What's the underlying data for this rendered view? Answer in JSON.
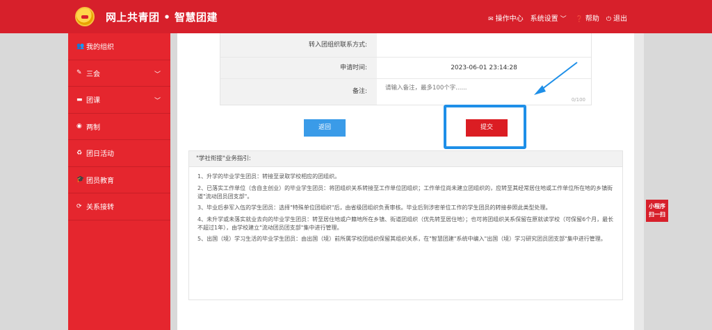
{
  "header": {
    "app_title": "网上共青团 • 智慧团建",
    "nav": [
      {
        "label": "操作中心",
        "icon": "envelope-icon"
      },
      {
        "label": "系统设置",
        "icon": "chevron-down-icon"
      },
      {
        "label": "帮助",
        "icon": "question-icon"
      },
      {
        "label": "退出",
        "icon": "power-icon"
      }
    ]
  },
  "sidebar": {
    "items": [
      {
        "label": "我的组织",
        "icon": "group-icon"
      },
      {
        "label": "三会",
        "icon": "edit-icon"
      },
      {
        "label": "团课",
        "icon": "folder-icon"
      },
      {
        "label": "两制",
        "icon": "circle-icon"
      },
      {
        "label": "团日活动",
        "icon": "recycle-icon"
      },
      {
        "label": "团员教育",
        "icon": "graduation-icon"
      },
      {
        "label": "关系接转",
        "icon": "refresh-icon"
      }
    ]
  },
  "form": {
    "contact_label": "转入团组织联系方式:",
    "contact_value": "",
    "time_label": "申请时间:",
    "time_value": "2023-06-01 23:14:28",
    "remark_label": "备注:",
    "remark_placeholder": "请输入备注，最多100个字......",
    "remark_counter": "0/100"
  },
  "buttons": {
    "back_label": "返回",
    "submit_label": "提交"
  },
  "guide": {
    "title": "\"学社衔接\"业务指引:",
    "items": [
      "1、升学的毕业学生团员：转接至录取学校相应的团组织。",
      "2、已落实工作单位（含自主创业）的毕业学生团员：将团组织关系转接至工作单位团组织；工作单位尚未建立团组织的，应转至其经常居住地或工作单位所在地的乡镇街道\"流动团员团支部\"。",
      "3、毕业后参军入伍的学生团员：选择\"特殊单位团组织\"后，由省级团组织负责审核。毕业后到涉密单位工作的学生团员的转接参照此类型处理。",
      "4、未升学或未落实就业去向的毕业学生团员：转至居住地或户籍地所在乡镇、街道团组织（优先转至居住地）；也可将团组织关系保留在原就读学校（可保留6个月，最长不超过1年），由学校建立\"流动团员团支部\"集中进行管理。",
      "5、出国（境）学习生活的毕业学生团员：由出国（境）前所属学校团组织保留其组织关系，在\"智慧团建\"系统中编入\"出国（境）学习研究团员团支部\"集中进行管理。"
    ]
  },
  "mini_program": {
    "line1": "小程序",
    "line2": "扫一扫"
  },
  "colors": {
    "brand_red": "#d7202b",
    "highlight_blue": "#1e8fe8",
    "back_button_blue": "#3a9be8"
  }
}
